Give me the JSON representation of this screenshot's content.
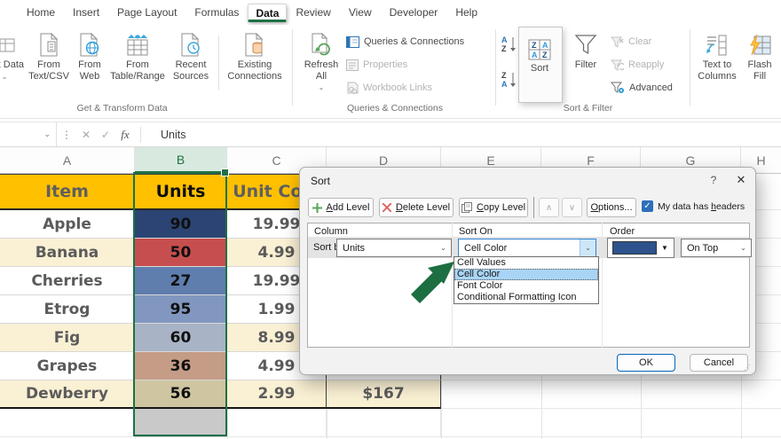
{
  "tab_bar": {
    "tabs": [
      "Home",
      "Insert",
      "Page Layout",
      "Formulas",
      "Data",
      "Review",
      "View",
      "Developer",
      "Help"
    ],
    "active_tab": "Data"
  },
  "ribbon": {
    "groups": {
      "get_transform": {
        "label": "Get & Transform Data"
      },
      "queries": {
        "label": "Queries & Connections"
      },
      "sort_filter": {
        "label": "Sort & Filter"
      }
    },
    "buttons": {
      "get_data": "Get Data",
      "from_text": "From Text/CSV",
      "from_web": "From Web",
      "from_table": "From Table/Range",
      "recent": "Recent Sources",
      "existing": "Existing Connections",
      "refresh": "Refresh All",
      "queries_connections": "Queries & Connections",
      "properties": "Properties",
      "workbook_links": "Workbook Links",
      "sort": "Sort",
      "filter": "Filter",
      "clear": "Clear",
      "reapply": "Reapply",
      "advanced": "Advanced",
      "text_to_columns": "Text to Columns",
      "flash_fill": "Flash Fill"
    }
  },
  "formula_bar": {
    "name_box_value": "",
    "value": "Units"
  },
  "icons": {
    "fx": "fx",
    "cancel": "✕",
    "enter": "✓",
    "chevron_down": "⌄",
    "more": "⋮",
    "dropdown_arrow": "▼",
    "up_arrow": "∧",
    "down_arrow": "∨",
    "check": "✓",
    "help": "?",
    "close": "✕",
    "grip": "⋰"
  },
  "sheet": {
    "column_headers": [
      "A",
      "B",
      "C",
      "D",
      "E",
      "F",
      "G",
      "H"
    ],
    "selected_column": "B",
    "table": {
      "header": {
        "item": "Item",
        "units": "Units",
        "unit_cost": "Unit Cost",
        "bg": "#FFC000"
      },
      "rows": [
        {
          "item": "Apple",
          "units": "90",
          "unit_cost": "19.99",
          "total": "",
          "row_bg": "#FFFFFF",
          "units_bg": "#2B4473"
        },
        {
          "item": "Banana",
          "units": "50",
          "unit_cost": "4.99",
          "total": "",
          "row_bg": "#FAF0D4",
          "units_bg": "#C64E4E"
        },
        {
          "item": "Cherries",
          "units": "27",
          "unit_cost": "19.99",
          "total": "",
          "row_bg": "#FFFFFF",
          "units_bg": "#5F7DAD"
        },
        {
          "item": "Etrog",
          "units": "95",
          "unit_cost": "1.99",
          "total": "",
          "row_bg": "#FFFFFF",
          "units_bg": "#8197BF"
        },
        {
          "item": "Fig",
          "units": "60",
          "unit_cost": "8.99",
          "total": "",
          "row_bg": "#FAF0D4",
          "units_bg": "#A9B3C6"
        },
        {
          "item": "Grapes",
          "units": "36",
          "unit_cost": "4.99",
          "total": "",
          "row_bg": "#FFFFFF",
          "units_bg": "#C59C86"
        },
        {
          "item": "Dewberry",
          "units": "56",
          "unit_cost": "2.99",
          "total": "$167",
          "row_bg": "#FAF0D4",
          "units_bg": "#CFC5A0"
        }
      ],
      "empty_cell_bg": "#C9C9C9"
    }
  },
  "dialog": {
    "title": "Sort",
    "toolbar": {
      "add_level": "&Add Level",
      "delete_level": "&Delete Level",
      "copy_level": "&Copy Level",
      "options": "&Options...",
      "my_data_has_headers": "My data has &headers",
      "headers_checked": true
    },
    "grid": {
      "column": "Column",
      "sort_on": "Sort On",
      "order": "Order",
      "sort_by": "Sort by",
      "column_value": "Units",
      "sort_on_value": "Cell Color",
      "order_value": "On Top",
      "order_swatch": "#2E538C"
    },
    "sort_on_options": [
      "Cell Values",
      "Cell Color",
      "Font Color",
      "Conditional Formatting Icon"
    ],
    "selected_option": "Cell Color",
    "ok": "OK",
    "cancel": "Cancel"
  },
  "colors": {
    "accent_green": "#1E7145",
    "header_gold": "#FFC000",
    "arrow_green": "#1D6F42",
    "dropdown_highlight": "#A9D4F5",
    "checkbox_blue": "#2D6FBA"
  }
}
